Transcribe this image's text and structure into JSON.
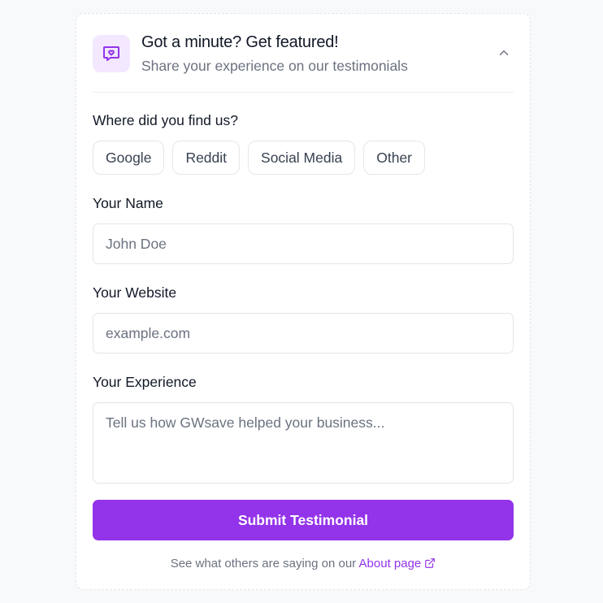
{
  "header": {
    "title": "Got a minute? Get featured!",
    "subtitle": "Share your experience on our testimonials",
    "icon": "message-heart-icon",
    "toggle_icon": "chevron-up-icon"
  },
  "source": {
    "label": "Where did you find us?",
    "options": [
      "Google",
      "Reddit",
      "Social Media",
      "Other"
    ]
  },
  "name": {
    "label": "Your Name",
    "placeholder": "John Doe"
  },
  "website": {
    "label": "Your Website",
    "placeholder": "example.com"
  },
  "experience": {
    "label": "Your Experience",
    "placeholder": "Tell us how GWsave helped your business..."
  },
  "submit_label": "Submit Testimonial",
  "footer": {
    "text": "See what others are saying on our",
    "link_text": "About page",
    "link_icon": "external-link-icon"
  },
  "colors": {
    "accent": "#9333ea",
    "accent_light": "#f3e8ff",
    "background": "#f8f9fb"
  }
}
